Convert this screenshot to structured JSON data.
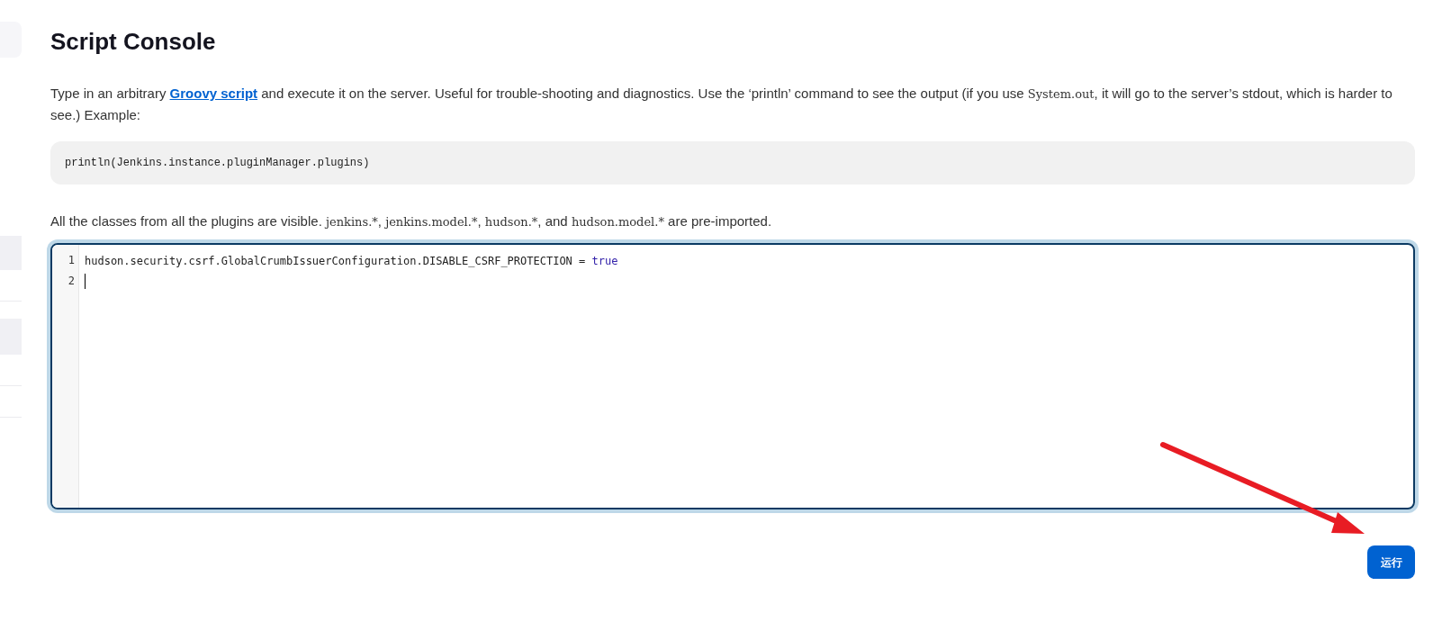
{
  "page": {
    "title": "Script Console"
  },
  "intro": [
    {
      "kind": "text",
      "text": "Type in an arbitrary "
    },
    {
      "kind": "link",
      "text": "Groovy script"
    },
    {
      "kind": "text",
      "text": " and execute it on the server. Useful for trouble-shooting and diagnostics. Use the ‘println’ command to see the output (if you use "
    },
    {
      "kind": "code",
      "text": "System.out"
    },
    {
      "kind": "text",
      "text": ", it will go to the server’s stdout, which is harder to see.) Example:"
    }
  ],
  "example": "println(Jenkins.instance.pluginManager.plugins)",
  "note": [
    {
      "kind": "text",
      "text": "All the classes from all the plugins are visible. "
    },
    {
      "kind": "code",
      "text": "jenkins.*",
      "after": ", "
    },
    {
      "kind": "code",
      "text": "jenkins.model.*",
      "after": ", "
    },
    {
      "kind": "code",
      "text": "hudson.*",
      "after": ", and "
    },
    {
      "kind": "code",
      "text": "hudson.model.*"
    },
    {
      "kind": "text",
      "text": " are pre-imported."
    }
  ],
  "editor": {
    "focused": true,
    "lines": [
      {
        "number": "1",
        "cursor": false,
        "tokens": [
          {
            "kind": "plain",
            "text": "hudson.security.csrf.GlobalCrumbIssuerConfiguration.DISABLE_CSRF_PROTECTION = "
          },
          {
            "kind": "keyword",
            "text": "true"
          }
        ]
      },
      {
        "number": "2",
        "cursor": true
      }
    ]
  },
  "run_button": {
    "label": "运行"
  }
}
